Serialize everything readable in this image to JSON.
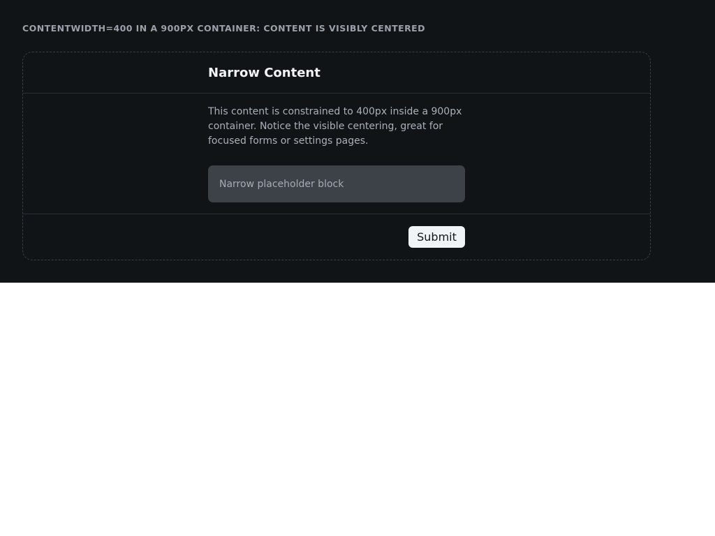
{
  "caption": "CONTENTWIDTH=400 IN A 900PX CONTAINER: CONTENT IS VISIBLY CENTERED",
  "card": {
    "title": "Narrow Content",
    "description": "This content is constrained to 400px inside a 900px container. Notice the visible centering, great for focused forms or settings pages.",
    "placeholder_block": "Narrow placeholder block",
    "submit_label": "Submit"
  },
  "colors": {
    "background": "#111416",
    "frame_border": "#3a3f45",
    "placeholder_fill": "#3d4148",
    "button_fill": "#f1f4f7"
  }
}
